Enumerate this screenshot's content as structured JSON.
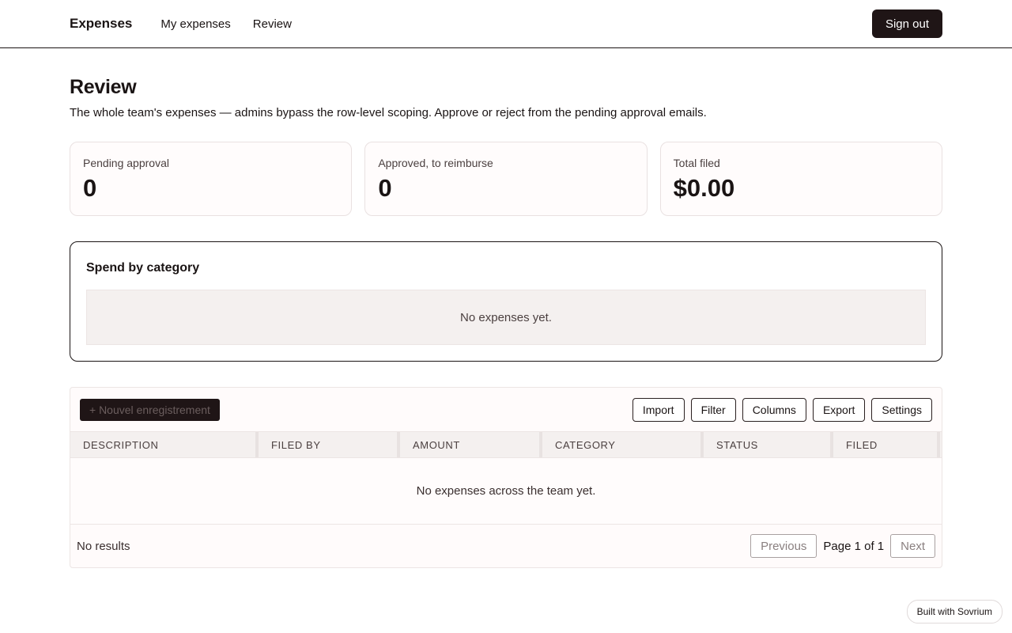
{
  "header": {
    "brand": "Expenses",
    "nav": [
      {
        "label": "My expenses"
      },
      {
        "label": "Review"
      }
    ],
    "sign_out_label": "Sign out"
  },
  "page": {
    "title": "Review",
    "subtitle": "The whole team's expenses — admins bypass the row-level scoping. Approve or reject from the pending approval emails."
  },
  "stats": [
    {
      "label": "Pending approval",
      "value": "0"
    },
    {
      "label": "Approved, to reimburse",
      "value": "0"
    },
    {
      "label": "Total filed",
      "value": "$0.00"
    }
  ],
  "category_panel": {
    "title": "Spend by category",
    "empty_text": "No expenses yet."
  },
  "table": {
    "new_record_label": "+ Nouvel enregistrement",
    "toolbar_buttons": [
      "Import",
      "Filter",
      "Columns",
      "Export",
      "Settings"
    ],
    "columns": [
      "DESCRIPTION",
      "FILED BY",
      "AMOUNT",
      "CATEGORY",
      "STATUS",
      "FILED"
    ],
    "empty_text": "No expenses across the team yet.",
    "results_text": "No results",
    "previous_label": "Previous",
    "page_info": "Page 1 of 1",
    "next_label": "Next"
  },
  "badge": {
    "label": "Built with Sovrium"
  }
}
